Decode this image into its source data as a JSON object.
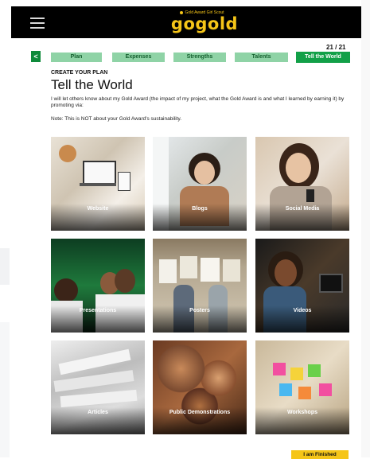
{
  "header": {
    "brand_small": "Gold Award Girl Scout",
    "brand_main": "gogold",
    "menu_icon": "hamburger-menu-icon"
  },
  "progress": {
    "counter": "21 / 21"
  },
  "nav": {
    "back_icon": "chevron-left-icon",
    "back_label": "<",
    "tabs": [
      {
        "label": "Plan"
      },
      {
        "label": "Expenses"
      },
      {
        "label": "Strengths"
      },
      {
        "label": "Talents"
      },
      {
        "label": "Tell the World",
        "active": true
      }
    ]
  },
  "content": {
    "eyebrow": "CREATE YOUR PLAN",
    "title": "Tell the World",
    "description": "I will let others know about my Gold Award (the impact of my project, what the Gold Award is and what I learned by earning it) by promoting via:",
    "note": "Note: This is NOT about your Gold Award's sustainability."
  },
  "tiles": [
    {
      "label": "Website"
    },
    {
      "label": "Blogs"
    },
    {
      "label": "Social Media"
    },
    {
      "label": "Presentations"
    },
    {
      "label": "Posters"
    },
    {
      "label": "Videos"
    },
    {
      "label": "Articles"
    },
    {
      "label": "Public Demonstrations"
    },
    {
      "label": "Workshops"
    }
  ],
  "footer": {
    "finish_label": "I am Finished"
  },
  "colors": {
    "tab_inactive": "#8fd3a6",
    "tab_active": "#12a048",
    "brand_gold": "#f5c518",
    "topbar": "#000000"
  }
}
